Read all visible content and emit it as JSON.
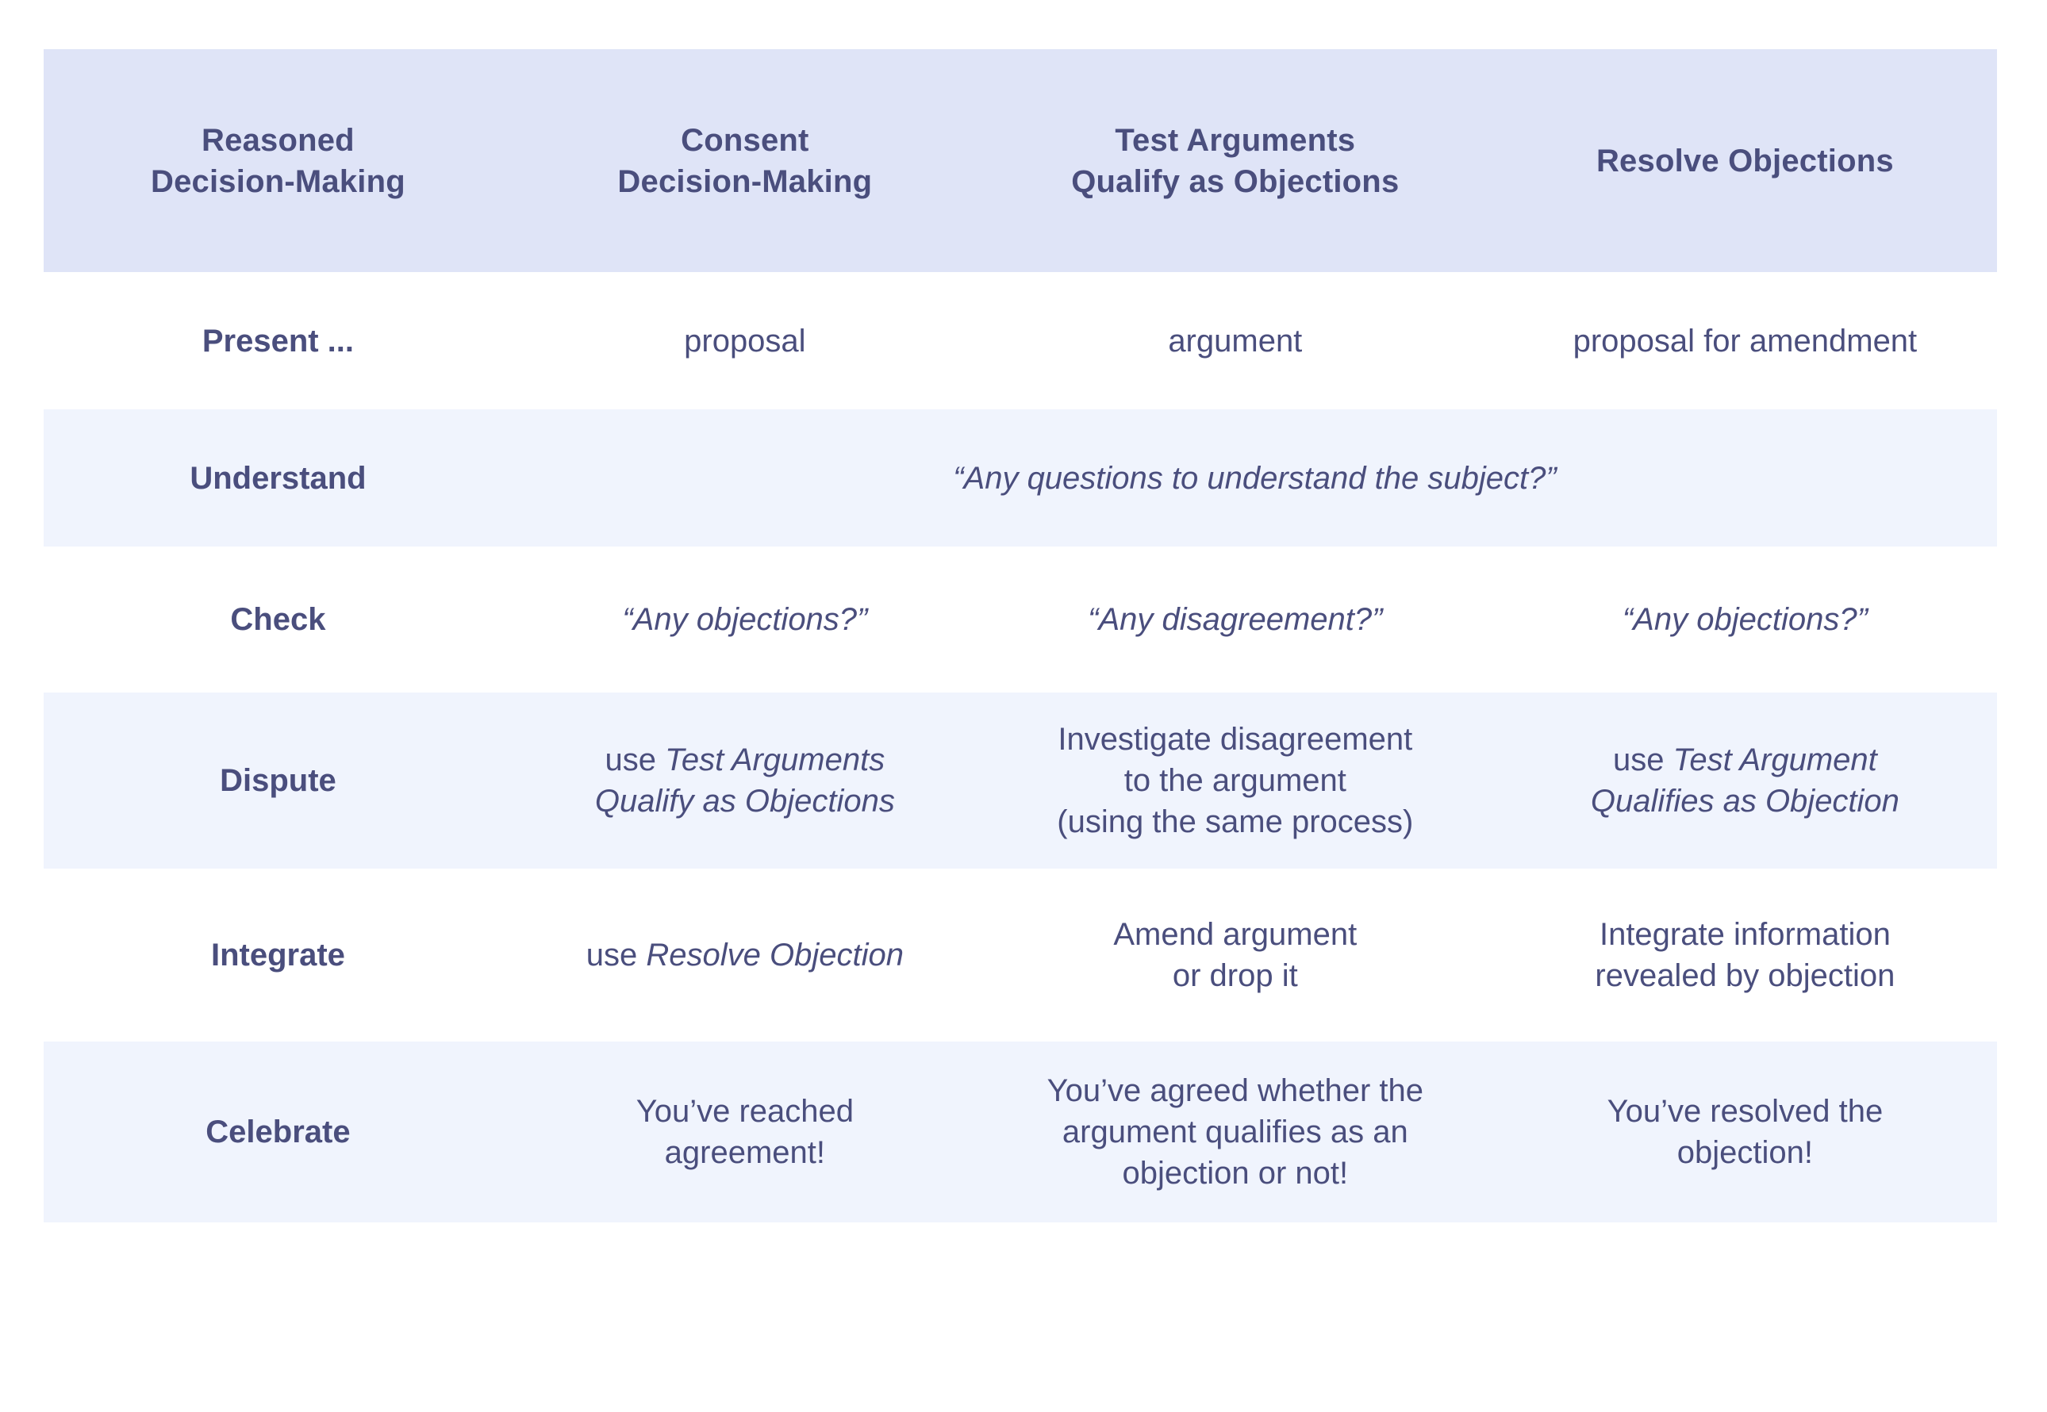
{
  "table": {
    "columns": [
      {
        "id": "stage",
        "lines": [
          "Reasoned",
          "Decision-Making"
        ]
      },
      {
        "id": "consent",
        "lines": [
          "Consent",
          "Decision-Making"
        ]
      },
      {
        "id": "test",
        "lines": [
          "Test Arguments",
          "Qualify as Objections"
        ]
      },
      {
        "id": "resolve",
        "lines": [
          "Resolve Objections"
        ]
      }
    ],
    "rows": [
      {
        "stage": "Present ...",
        "consent": {
          "lines": [
            {
              "text": "proposal"
            }
          ]
        },
        "test": {
          "lines": [
            {
              "text": "argument"
            }
          ]
        },
        "resolve": {
          "lines": [
            {
              "text": "proposal for amendment"
            }
          ]
        }
      },
      {
        "stage": "Understand",
        "merged": {
          "text": "“Any questions to understand the subject?”",
          "style": "italic"
        }
      },
      {
        "stage": "Check",
        "consent": {
          "lines": [
            {
              "text": "“Any objections?”",
              "style": "italic"
            }
          ]
        },
        "test": {
          "lines": [
            {
              "text": "“Any disagreement?”",
              "style": "italic"
            }
          ]
        },
        "resolve": {
          "lines": [
            {
              "text": "“Any objections?”",
              "style": "italic"
            }
          ]
        }
      },
      {
        "stage": "Dispute",
        "consent": {
          "lines": [
            {
              "prefix": "use ",
              "em": "Test Arguments"
            },
            {
              "em": "Qualify as Objections"
            }
          ]
        },
        "test": {
          "lines": [
            {
              "text": "Investigate disagreement"
            },
            {
              "text": "to the argument"
            },
            {
              "text": "(using the same process)"
            }
          ]
        },
        "resolve": {
          "lines": [
            {
              "prefix": "use ",
              "em": "Test Argument"
            },
            {
              "em": "Qualifies as Objection"
            }
          ]
        }
      },
      {
        "stage": "Integrate",
        "consent": {
          "lines": [
            {
              "prefix": "use ",
              "em": "Resolve Objection"
            }
          ]
        },
        "test": {
          "lines": [
            {
              "text": "Amend argument"
            },
            {
              "text": "or drop it"
            }
          ]
        },
        "resolve": {
          "lines": [
            {
              "text": "Integrate information"
            },
            {
              "text": "revealed by objection"
            }
          ]
        }
      },
      {
        "stage": "Celebrate",
        "consent": {
          "lines": [
            {
              "text": "You’ve reached"
            },
            {
              "text": "agreement!"
            }
          ]
        },
        "test": {
          "lines": [
            {
              "text": "You’ve agreed whether the"
            },
            {
              "text": "argument qualifies as an"
            },
            {
              "text": "objection or not!"
            }
          ]
        },
        "resolve": {
          "lines": [
            {
              "text": "You’ve resolved the"
            },
            {
              "text": "objection!"
            }
          ]
        }
      }
    ]
  },
  "colors": {
    "header_background": "#dfe4f7",
    "row_tint_background": "#f0f4fd",
    "row_plain_background": "#ffffff",
    "text": "#4a4e7d",
    "page_background": "#ffffff"
  }
}
